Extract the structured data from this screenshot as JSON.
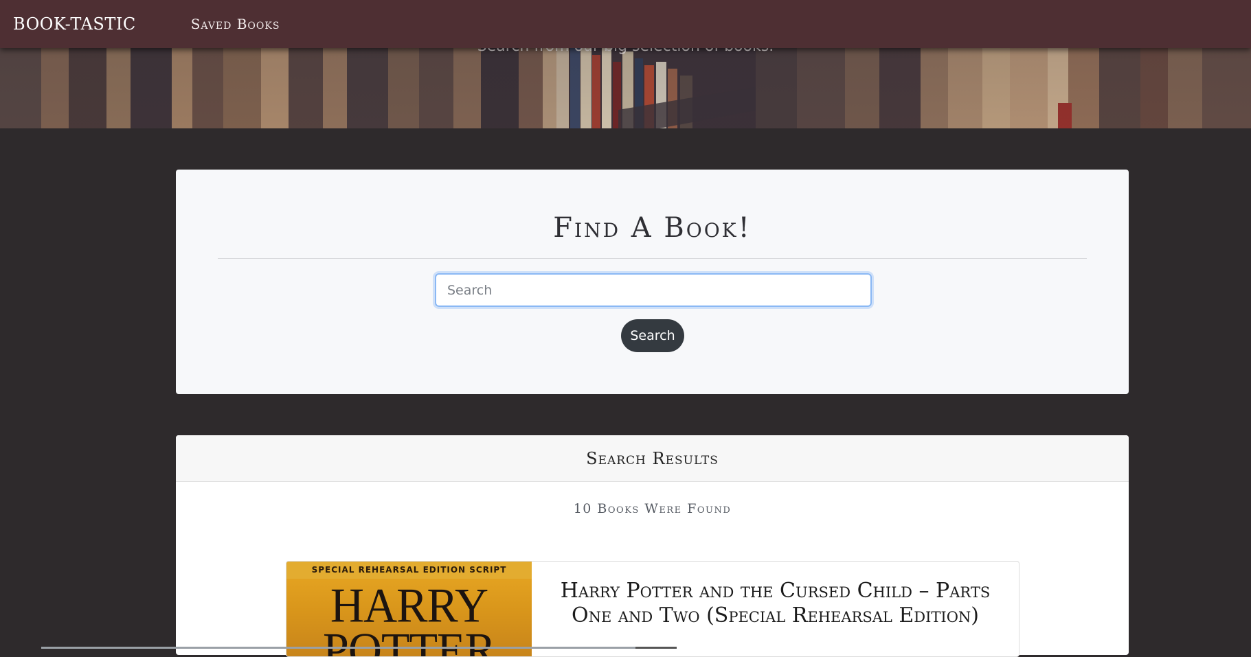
{
  "navbar": {
    "brand": "BOOK-TASTIC",
    "saved_books": "Saved Books"
  },
  "hero": {
    "subtitle": "Search from our big selection of books."
  },
  "search": {
    "title": "Find A Book!",
    "placeholder": "Search",
    "button": "Search"
  },
  "results": {
    "header": "Search Results",
    "count": "10 Books Were Found",
    "books": [
      {
        "cover_banner": "SPECIAL REHEARSAL EDITION SCRIPT",
        "cover_text": "HARRY POTTER",
        "title": "Harry Potter and the Cursed Child – Parts One and Two (Special Rehearsal Edition)"
      }
    ]
  },
  "colors": {
    "navbar": "#4e2f33",
    "page_background": "#2e2a2c",
    "button": "#343a40",
    "input_focus": "#8ab8f4"
  }
}
